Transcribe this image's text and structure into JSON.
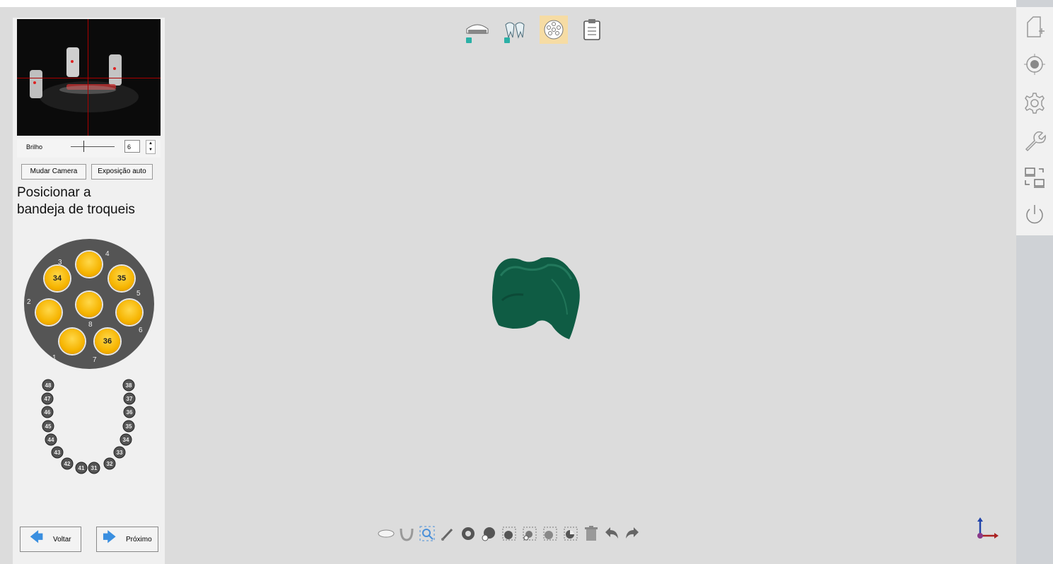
{
  "camera": {
    "brightness_label": "Brilho",
    "brightness_value": "6"
  },
  "buttons": {
    "change_camera": "Mudar Camera",
    "auto_exposure": "Exposição auto",
    "back": "Voltar",
    "next": "Próximo"
  },
  "instruction": {
    "line1": "Posicionar a",
    "line2": "bandeja de troqueis"
  },
  "tray": {
    "slot_labels": [
      "34",
      "35",
      "36"
    ],
    "position_numbers": [
      "1",
      "2",
      "3",
      "4",
      "5",
      "6",
      "7",
      "8"
    ]
  },
  "arch": {
    "left": [
      "48",
      "47",
      "46",
      "45",
      "44",
      "43",
      "42",
      "41"
    ],
    "right": [
      "38",
      "37",
      "36",
      "35",
      "34",
      "33",
      "32",
      "31"
    ]
  },
  "workflow_steps": [
    {
      "name": "upper-jaw-icon",
      "checked": true
    },
    {
      "name": "teeth-icon",
      "checked": true
    },
    {
      "name": "die-tray-icon",
      "active": true
    },
    {
      "name": "clipboard-icon"
    }
  ],
  "colors": {
    "accent": "#f6dca4",
    "model": "#0f5c44",
    "slot": "#f6b400"
  }
}
